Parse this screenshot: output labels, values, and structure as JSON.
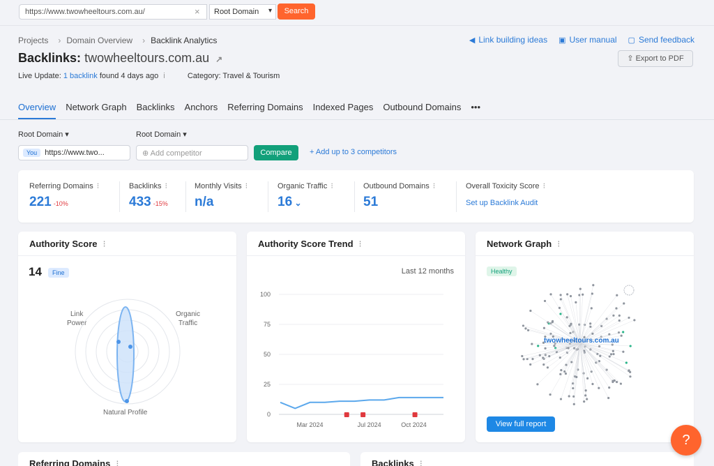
{
  "search": {
    "value": "https://www.twowheeltours.com.au/",
    "scope": "Root Domain",
    "button": "Search"
  },
  "breadcrumb": [
    "Projects",
    "Domain Overview",
    "Backlink Analytics"
  ],
  "toplinks": {
    "ideas": "Link building ideas",
    "manual": "User manual",
    "feedback": "Send feedback"
  },
  "header": {
    "title": "Backlinks:",
    "domain": "twowheeltours.com.au",
    "export": "Export to PDF"
  },
  "live": {
    "prefix": "Live Update:",
    "link": "1 backlink",
    "suffix": "found 4 days ago",
    "info": "i",
    "category": "Category: Travel & Tourism"
  },
  "tabs": [
    "Overview",
    "Network Graph",
    "Backlinks",
    "Anchors",
    "Referring Domains",
    "Indexed Pages",
    "Outbound Domains",
    "•••"
  ],
  "compare": {
    "scope1": "Root Domain",
    "scope2": "Root Domain",
    "you_tag": "You",
    "you_value": "https://www.two...",
    "placeholder": "Add competitor",
    "button": "Compare",
    "add": "+  Add up to 3 competitors"
  },
  "metrics": {
    "referring_domains": {
      "label": "Referring Domains",
      "value": "221",
      "change": "-10%"
    },
    "backlinks": {
      "label": "Backlinks",
      "value": "433",
      "change": "-15%"
    },
    "monthly_visits": {
      "label": "Monthly Visits",
      "value": "n/a"
    },
    "organic_traffic": {
      "label": "Organic Traffic",
      "value": "16"
    },
    "outbound_domains": {
      "label": "Outbound Domains",
      "value": "51"
    },
    "toxicity": {
      "label": "Overall Toxicity Score",
      "link": "Set up Backlink Audit"
    }
  },
  "authority": {
    "title": "Authority Score",
    "score": "14",
    "tag": "Fine",
    "axes": {
      "link_power_1": "Link",
      "link_power_2": "Power",
      "organic_1": "Organic",
      "organic_2": "Traffic",
      "natural": "Natural Profile"
    }
  },
  "trend": {
    "title": "Authority Score Trend",
    "range": "Last 12 months"
  },
  "network": {
    "title": "Network Graph",
    "tag": "Healthy",
    "center_label": "twowheeltours.com.au",
    "button": "View full report"
  },
  "bottom": {
    "left_title": "Referring Domains",
    "right_title": "Backlinks"
  },
  "help": "?",
  "chart_data": {
    "type": "line",
    "x": [
      "2024-01",
      "2024-02",
      "2024-03",
      "2024-04",
      "2024-05",
      "2024-06",
      "2024-07",
      "2024-08",
      "2024-09",
      "2024-10",
      "2024-11",
      "2024-12"
    ],
    "xticks": [
      "Mar 2024",
      "Jul 2024",
      "Oct 2024"
    ],
    "series": [
      {
        "values": [
          10,
          5,
          10,
          10,
          11,
          11,
          12,
          12,
          14,
          14,
          14,
          14
        ]
      }
    ],
    "ylim": [
      0,
      100
    ],
    "yticks": [
      0,
      25,
      50,
      75,
      100
    ],
    "grid": true
  }
}
